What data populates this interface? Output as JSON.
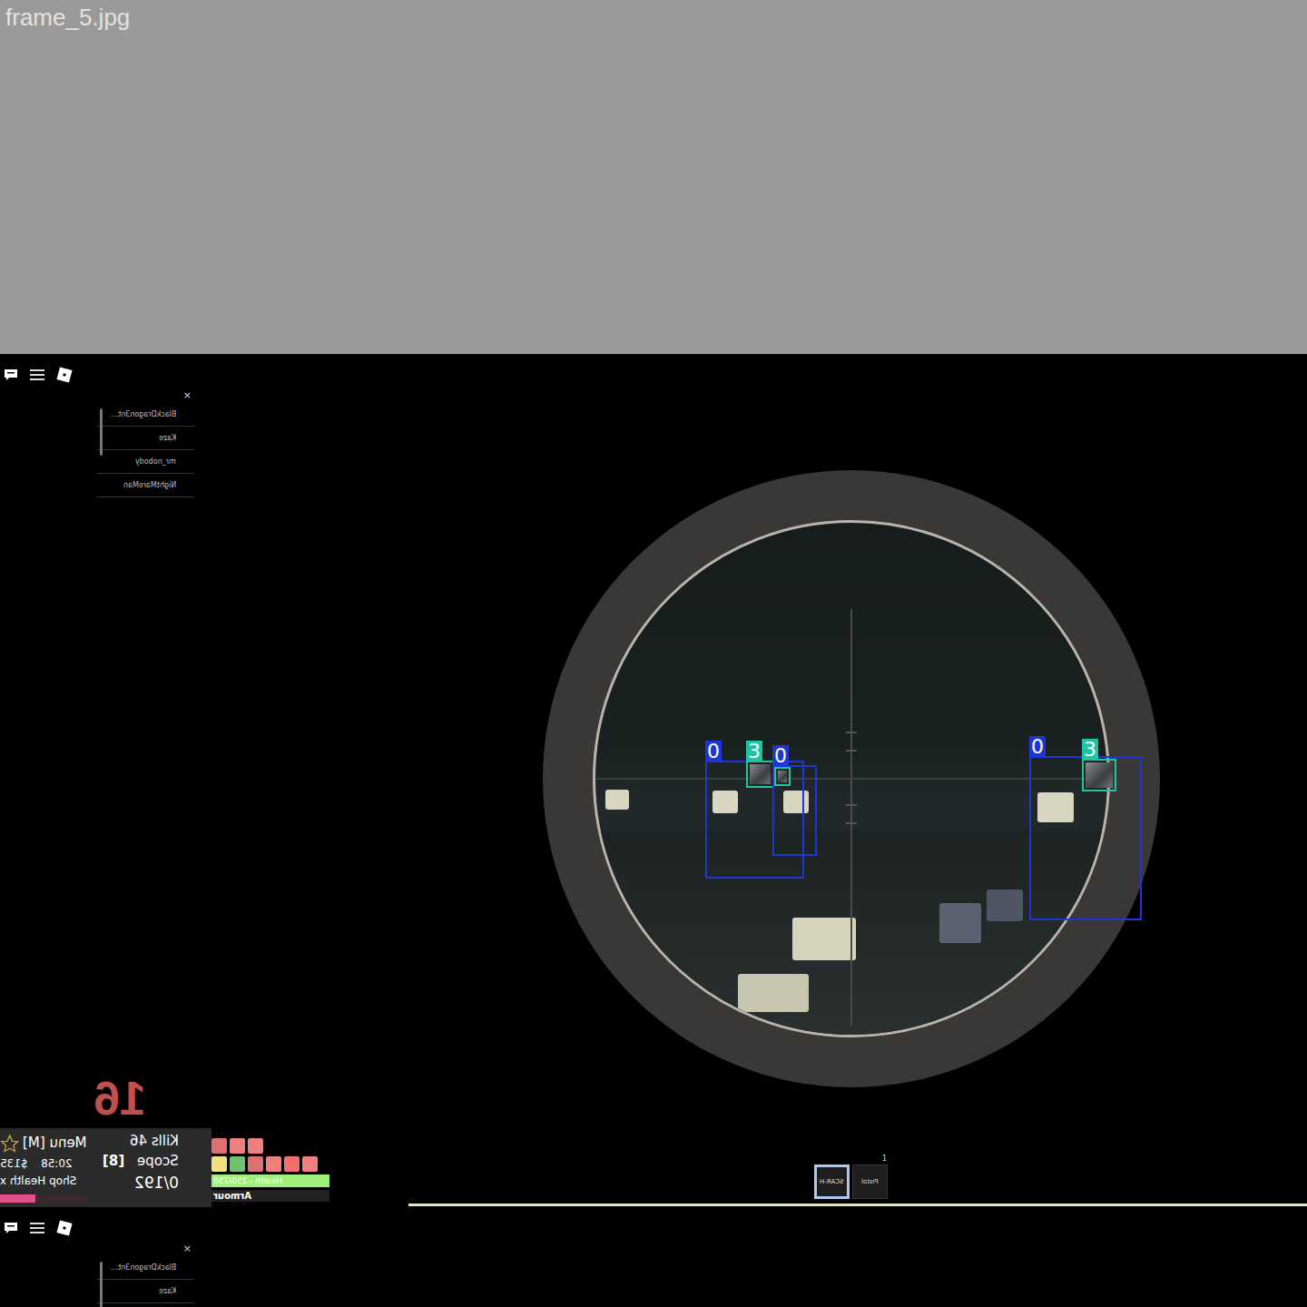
{
  "frame_label": "frame_5.jpg",
  "player_list": {
    "close": "×",
    "players": [
      "BlackDragon3nt…",
      "Kaze",
      "mr_nobody",
      "NightMareMan"
    ]
  },
  "detections": [
    {
      "kind": "labeled",
      "label": "0",
      "color": "#1e36d6"
    },
    {
      "kind": "labeled",
      "label": "3",
      "color": "#1fc4a0"
    },
    {
      "kind": "labeled",
      "label": "0",
      "color": "#1e36d6"
    },
    {
      "kind": "unlabeled",
      "color": "#1fc4a0"
    },
    {
      "kind": "labeled",
      "label": "0",
      "color": "#1e36d6"
    },
    {
      "kind": "labeled",
      "label": "3",
      "color": "#1fc4a0"
    }
  ],
  "hud": {
    "ammo_big": "16",
    "menu": "Menu [M]",
    "kills": "Kills 46",
    "money": "$135",
    "time": "20:58",
    "scope_key": "[8]",
    "scope": "Scope",
    "shop": "Shop Health x",
    "ammo": "0/192",
    "armour_level": 0.41,
    "health": "Health - 250/250",
    "health_level": 1,
    "armour": "Armour"
  },
  "hotbar": [
    {
      "label": "SCAR-H",
      "selected": true,
      "key": ""
    },
    {
      "label": "Pistol",
      "selected": false,
      "key": "1"
    }
  ],
  "strip": {
    "close": "×",
    "players": [
      "BlackDragon3nt…",
      "Kaze"
    ]
  }
}
